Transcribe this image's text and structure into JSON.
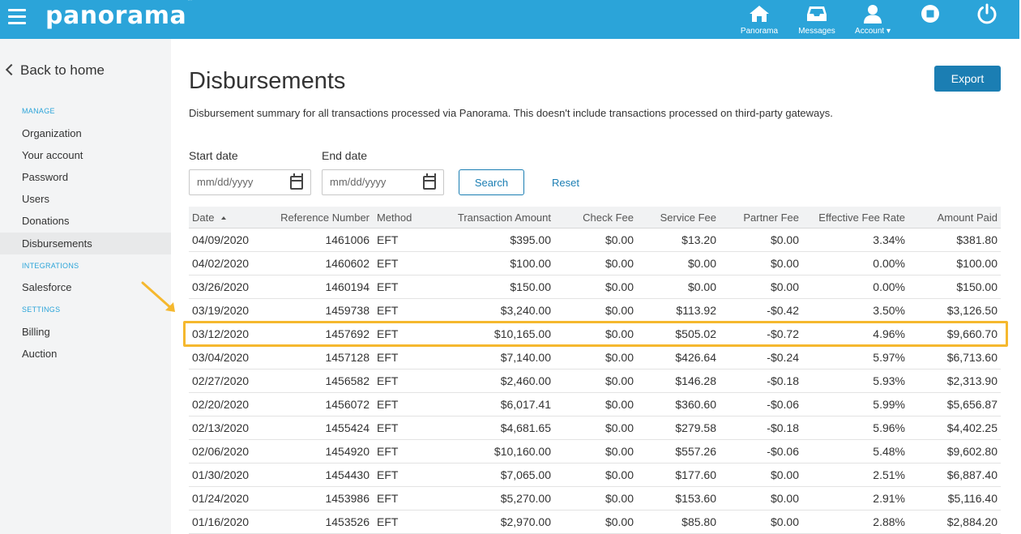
{
  "app": {
    "logo_text": "panorama",
    "logo_tm": "™",
    "brand_color": "#2ba4d9",
    "accent_color": "#1b7eb3",
    "highlight_color": "#f5b82e"
  },
  "topnav": {
    "items": [
      {
        "label": "Panorama",
        "icon": "home-icon"
      },
      {
        "label": "Messages",
        "icon": "inbox-icon"
      },
      {
        "label": "Account ▾",
        "icon": "user-icon"
      },
      {
        "label": "",
        "icon": "stop-icon"
      },
      {
        "label": "",
        "icon": "power-icon"
      }
    ]
  },
  "sidebar": {
    "back_label": "Back to home",
    "sections": {
      "manage": "MANAGE",
      "integrations": "INTEGRATIONS",
      "settings": "SETTINGS"
    },
    "items": [
      {
        "label": "Organization"
      },
      {
        "label": "Your account"
      },
      {
        "label": "Password"
      },
      {
        "label": "Users"
      },
      {
        "label": "Donations"
      },
      {
        "label": "Disbursements",
        "active": true
      },
      {
        "label": "Salesforce"
      },
      {
        "label": "Billing"
      },
      {
        "label": "Auction"
      }
    ]
  },
  "page": {
    "title": "Disbursements",
    "subtitle": "Disbursement summary for all transactions processed via Panorama. This doesn't include transactions processed on third-party gateways.",
    "export_label": "Export"
  },
  "filters": {
    "start_label": "Start date",
    "end_label": "End date",
    "start_placeholder": "mm/dd/yyyy",
    "end_placeholder": "mm/dd/yyyy",
    "search_label": "Search",
    "reset_label": "Reset"
  },
  "table": {
    "columns": [
      "Date",
      "Reference Number",
      "Method",
      "Transaction Amount",
      "Check Fee",
      "Service Fee",
      "Partner Fee",
      "Effective Fee Rate",
      "Amount Paid"
    ],
    "sorted_column": "Date",
    "sort_direction": "asc",
    "rows": [
      [
        "04/09/2020",
        "1461006",
        "EFT",
        "$395.00",
        "$0.00",
        "$13.20",
        "$0.00",
        "3.34%",
        "$381.80"
      ],
      [
        "04/02/2020",
        "1460602",
        "EFT",
        "$100.00",
        "$0.00",
        "$0.00",
        "$0.00",
        "0.00%",
        "$100.00"
      ],
      [
        "03/26/2020",
        "1460194",
        "EFT",
        "$150.00",
        "$0.00",
        "$0.00",
        "$0.00",
        "0.00%",
        "$150.00"
      ],
      [
        "03/19/2020",
        "1459738",
        "EFT",
        "$3,240.00",
        "$0.00",
        "$113.92",
        "-$0.42",
        "3.50%",
        "$3,126.50"
      ],
      [
        "03/12/2020",
        "1457692",
        "EFT",
        "$10,165.00",
        "$0.00",
        "$505.02",
        "-$0.72",
        "4.96%",
        "$9,660.70"
      ],
      [
        "03/04/2020",
        "1457128",
        "EFT",
        "$7,140.00",
        "$0.00",
        "$426.64",
        "-$0.24",
        "5.97%",
        "$6,713.60"
      ],
      [
        "02/27/2020",
        "1456582",
        "EFT",
        "$2,460.00",
        "$0.00",
        "$146.28",
        "-$0.18",
        "5.93%",
        "$2,313.90"
      ],
      [
        "02/20/2020",
        "1456072",
        "EFT",
        "$6,017.41",
        "$0.00",
        "$360.60",
        "-$0.06",
        "5.99%",
        "$5,656.87"
      ],
      [
        "02/13/2020",
        "1455424",
        "EFT",
        "$4,681.65",
        "$0.00",
        "$279.58",
        "-$0.18",
        "5.96%",
        "$4,402.25"
      ],
      [
        "02/06/2020",
        "1454920",
        "EFT",
        "$10,160.00",
        "$0.00",
        "$557.26",
        "-$0.06",
        "5.48%",
        "$9,602.80"
      ],
      [
        "01/30/2020",
        "1454430",
        "EFT",
        "$7,065.00",
        "$0.00",
        "$177.60",
        "$0.00",
        "2.51%",
        "$6,887.40"
      ],
      [
        "01/24/2020",
        "1453986",
        "EFT",
        "$5,270.00",
        "$0.00",
        "$153.60",
        "$0.00",
        "2.91%",
        "$5,116.40"
      ],
      [
        "01/16/2020",
        "1453526",
        "EFT",
        "$2,970.00",
        "$0.00",
        "$85.80",
        "$0.00",
        "2.88%",
        "$2,884.20"
      ]
    ],
    "highlighted_row": 4
  }
}
